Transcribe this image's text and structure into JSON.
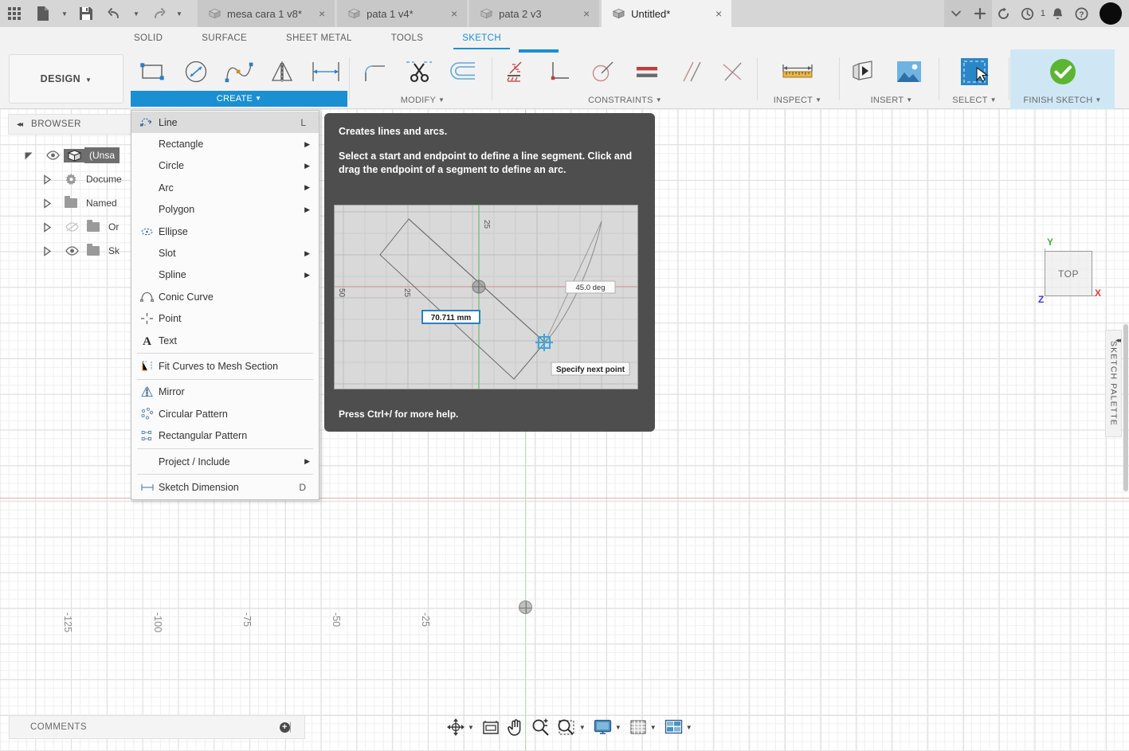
{
  "titlebar": {
    "apps_icon": "grid-apps-icon",
    "new_icon": "new-document-icon",
    "save_icon": "save-icon",
    "undo_icon": "undo-icon",
    "redo_icon": "redo-icon",
    "tabs": [
      {
        "label": "mesa cara 1 v8*",
        "active": false
      },
      {
        "label": "pata 1 v4*",
        "active": false
      },
      {
        "label": "pata 2 v3",
        "active": false
      },
      {
        "label": "Untitled*",
        "active": true
      }
    ],
    "close_glyph": "×",
    "tab_overflow_glyph": "⌄",
    "new_tab_glyph": "+",
    "refresh_icon": "refresh-icon",
    "jobs_icon": "job-status-icon",
    "jobs_count": "1",
    "bell_icon": "notifications-icon",
    "help_icon": "help-icon",
    "avatar": "user-avatar"
  },
  "ribbon_tabs": [
    {
      "label": "SOLID",
      "active": false
    },
    {
      "label": "SURFACE",
      "active": false
    },
    {
      "label": "SHEET METAL",
      "active": false
    },
    {
      "label": "TOOLS",
      "active": false
    },
    {
      "label": "SKETCH",
      "active": true
    }
  ],
  "workspace": {
    "label": "DESIGN",
    "caret": "▾"
  },
  "panels": [
    {
      "name": "CREATE",
      "label": "CREATE",
      "highlighted": true,
      "tools": [
        "rectangle-tool",
        "circle-tool",
        "spline-tool",
        "mirror-tool",
        "sketch-dimension-tool"
      ]
    },
    {
      "name": "MODIFY",
      "label": "MODIFY",
      "highlighted": false,
      "tools": [
        "fillet-tool",
        "trim-tool",
        "offset-tool"
      ]
    },
    {
      "name": "CONSTRAINTS",
      "label": "CONSTRAINTS",
      "highlighted": false,
      "tools": [
        "fix-unfix-constraint",
        "vertical-horizontal-constraint",
        "tangent-constraint",
        "equal-constraint",
        "parallel-constraint",
        "perpendicular-constraint"
      ]
    },
    {
      "name": "INSPECT",
      "label": "INSPECT",
      "highlighted": false,
      "tools": [
        "measure-tool"
      ]
    },
    {
      "name": "INSERT",
      "label": "INSERT",
      "highlighted": false,
      "tools": [
        "insert-derive-tool",
        "insert-canvas-tool"
      ]
    },
    {
      "name": "SELECT",
      "label": "SELECT",
      "highlighted": false,
      "tools": [
        "select-tool"
      ]
    },
    {
      "name": "FINISH SKETCH",
      "label": "FINISH SKETCH",
      "highlighted": false,
      "tools": [
        "finish-sketch-check"
      ]
    }
  ],
  "create_menu": {
    "items": [
      {
        "label": "Line",
        "icon": "line-icon",
        "shortcut": "L",
        "submenu": false,
        "highlighted": true
      },
      {
        "label": "Rectangle",
        "icon": "",
        "shortcut": "",
        "submenu": true,
        "highlighted": false
      },
      {
        "label": "Circle",
        "icon": "",
        "shortcut": "",
        "submenu": true,
        "highlighted": false
      },
      {
        "label": "Arc",
        "icon": "",
        "shortcut": "",
        "submenu": true,
        "highlighted": false
      },
      {
        "label": "Polygon",
        "icon": "",
        "shortcut": "",
        "submenu": true,
        "highlighted": false
      },
      {
        "label": "Ellipse",
        "icon": "ellipse-icon",
        "shortcut": "",
        "submenu": false,
        "highlighted": false
      },
      {
        "label": "Slot",
        "icon": "",
        "shortcut": "",
        "submenu": true,
        "highlighted": false
      },
      {
        "label": "Spline",
        "icon": "",
        "shortcut": "",
        "submenu": true,
        "highlighted": false
      },
      {
        "label": "Conic Curve",
        "icon": "conic-curve-icon",
        "shortcut": "",
        "submenu": false,
        "highlighted": false
      },
      {
        "label": "Point",
        "icon": "point-icon",
        "shortcut": "",
        "submenu": false,
        "highlighted": false
      },
      {
        "label": "Text",
        "icon": "text-icon",
        "shortcut": "",
        "submenu": false,
        "highlighted": false
      },
      {
        "label": "Fit Curves to Mesh Section",
        "icon": "fit-curves-icon",
        "shortcut": "",
        "submenu": false,
        "highlighted": false,
        "sep_before": true
      },
      {
        "label": "Mirror",
        "icon": "mirror-icon",
        "shortcut": "",
        "submenu": false,
        "highlighted": false,
        "sep_before": true
      },
      {
        "label": "Circular Pattern",
        "icon": "circular-pattern-icon",
        "shortcut": "",
        "submenu": false,
        "highlighted": false
      },
      {
        "label": "Rectangular Pattern",
        "icon": "rectangular-pattern-icon",
        "shortcut": "",
        "submenu": false,
        "highlighted": false
      },
      {
        "label": "Project / Include",
        "icon": "",
        "shortcut": "",
        "submenu": true,
        "highlighted": false,
        "sep_before": true
      },
      {
        "label": "Sketch Dimension",
        "icon": "sketch-dimension-icon",
        "shortcut": "D",
        "submenu": false,
        "highlighted": false,
        "sep_before": true
      }
    ]
  },
  "tooltip": {
    "title": "Creates lines and arcs.",
    "body": "Select a start and endpoint to define a line segment. Click and drag the endpoint of a segment to define an arc.",
    "footer": "Press Ctrl+/ for more help.",
    "preview": {
      "length_label": "70.711 mm",
      "angle_label": "45.0 deg",
      "hint_label": "Specify next point",
      "tick_top": "25",
      "tick_left": "25",
      "tick_edge": "50"
    }
  },
  "browser": {
    "title": "BROWSER",
    "collapse_glyph": "◂◂",
    "tree": [
      {
        "label": "(Unsa",
        "icon": "component-icon",
        "eye": "visible",
        "selected": true,
        "expander": "expanded"
      },
      {
        "label": "Docume",
        "icon": "settings-gear-icon",
        "eye": "none",
        "selected": false,
        "expander": "collapsed"
      },
      {
        "label": "Named ",
        "icon": "folder-icon",
        "eye": "none",
        "selected": false,
        "expander": "collapsed"
      },
      {
        "label": "Or",
        "icon": "folder-icon",
        "eye": "hidden",
        "selected": false,
        "expander": "collapsed"
      },
      {
        "label": "Sk",
        "icon": "folder-icon",
        "eye": "visible",
        "selected": false,
        "expander": "collapsed"
      }
    ]
  },
  "canvas": {
    "ruler_labels": [
      "-125",
      "-100",
      "-75",
      "-50",
      "-25"
    ],
    "viewcube_face": "TOP",
    "axis_y": "Y",
    "axis_x": "X",
    "axis_z": "Z",
    "grid_color": "#dedede",
    "x_axis_color": "#e2b0b0",
    "y_axis_color": "#b5dcb5"
  },
  "sketch_palette": {
    "label": "SKETCH PALETTE",
    "collapse_glyph": "◂◂"
  },
  "comments": {
    "label": "COMMENTS",
    "add_glyph": "+"
  },
  "navbar": {
    "items": [
      {
        "name": "orbit-tool",
        "caret": true
      },
      {
        "name": "look-at-tool",
        "caret": false
      },
      {
        "name": "pan-tool",
        "caret": false
      },
      {
        "name": "zoom-tool",
        "caret": false
      },
      {
        "name": "zoom-window-tool",
        "caret": true
      },
      {
        "name": "display-settings",
        "caret": true
      },
      {
        "name": "grid-snaps",
        "caret": true
      },
      {
        "name": "viewports",
        "caret": true
      }
    ]
  },
  "colors": {
    "accent": "#1a8fd1",
    "titlebar_bg": "#d6d6d6",
    "ribbon_bg": "#f2f2f2",
    "tooltip_bg": "#4e4e4e",
    "finish_bg": "#cfe7f5"
  }
}
